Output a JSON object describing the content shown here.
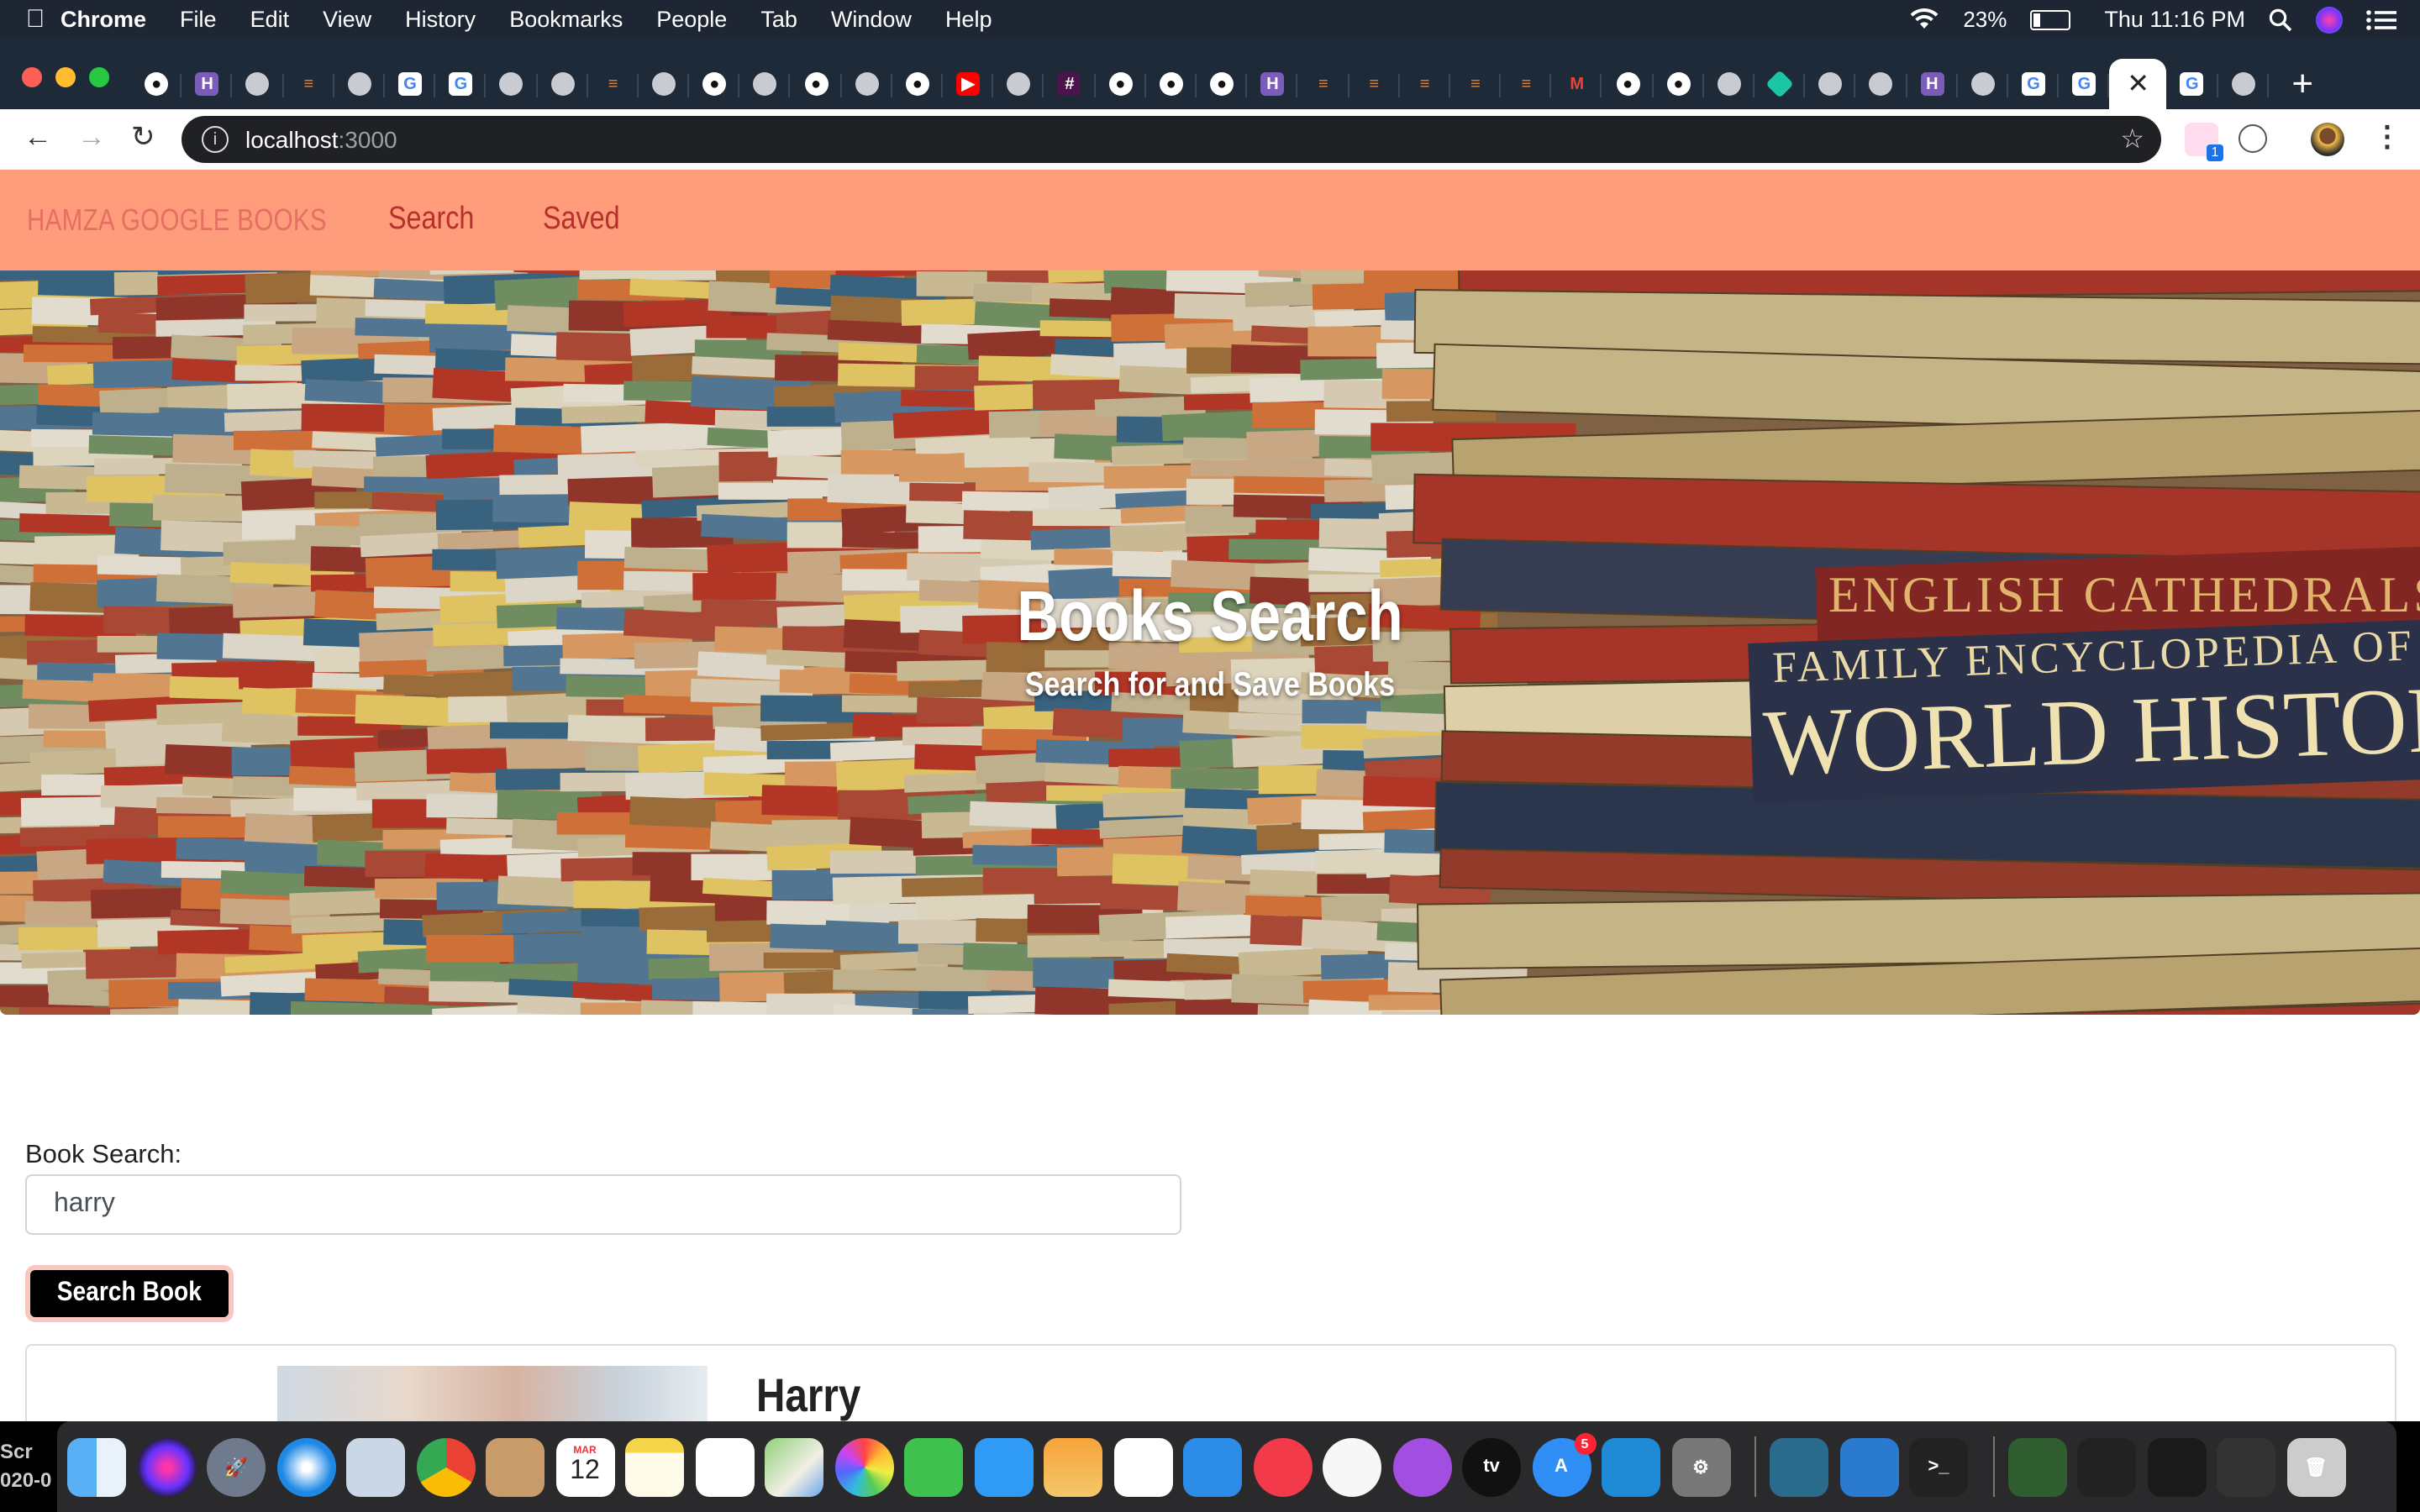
{
  "menubar": {
    "app": "Chrome",
    "items": [
      "File",
      "Edit",
      "View",
      "History",
      "Bookmarks",
      "People",
      "Tab",
      "Window",
      "Help"
    ],
    "battery": "23%",
    "clock": "Thu 11:16 PM"
  },
  "browser": {
    "url_host": "localhost",
    "url_port": ":3000",
    "favicons": [
      "github",
      "hack",
      "globe",
      "stack",
      "globe",
      "google",
      "google",
      "globe",
      "globe",
      "stack",
      "globe",
      "github",
      "globe",
      "github",
      "globe",
      "github",
      "youtube",
      "globe",
      "slack",
      "github",
      "github",
      "github",
      "hack",
      "stack",
      "stack",
      "stack",
      "stack",
      "stack",
      "gmail",
      "github",
      "github",
      "globe",
      "diamond",
      "globe",
      "globe",
      "hack",
      "globe",
      "google",
      "google"
    ],
    "active_tab_close": "✕",
    "inactive_after": [
      "google",
      "globe"
    ],
    "new_tab": "+",
    "ext_badge": "1"
  },
  "page": {
    "brand": "HAMZA GOOGLE BOOKS",
    "nav": [
      "Search",
      "Saved"
    ],
    "hero_title": "Books Search",
    "hero_subtitle": "Search for and Save Books",
    "hero_spine_lines": [
      "ENGLISH CATHEDRALS",
      "FAMILY ENCYCLOPEDIA OF",
      "WORLD HISTORY"
    ],
    "search_label": "Book Search:",
    "search_value": "harry",
    "search_button": "Search Book",
    "result_title": "Harry"
  },
  "dock": {
    "calendar_month": "MAR",
    "calendar_day": "12",
    "appstore_badge": "5",
    "side_text": [
      "Scr",
      "020-0"
    ]
  },
  "colors": {
    "navbar": "#fe9c7b",
    "brand": "#e46f62",
    "navlink": "#b5312c",
    "menubar": "#1f2633",
    "tabstrip": "#1e2a38"
  }
}
